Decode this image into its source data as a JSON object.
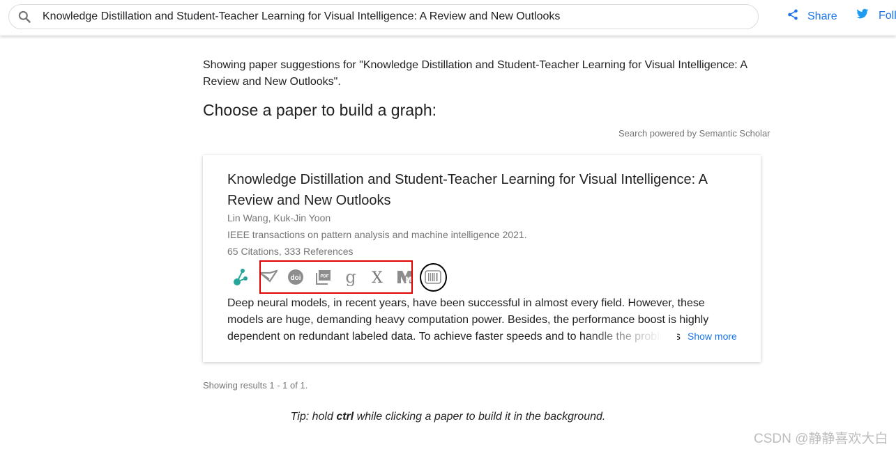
{
  "search": {
    "query": "Knowledge Distillation and Student-Teacher Learning for Visual Intelligence: A Review and New Outlooks"
  },
  "header": {
    "share_label": "Share",
    "follow_label": "Foll"
  },
  "intro_text": "Showing paper suggestions for \"Knowledge Distillation and Student-Teacher Learning for Visual Intelligence: A Review and New Outlooks\".",
  "heading": "Choose a paper to build a graph:",
  "powered_by": "Search powered by Semantic Scholar",
  "paper": {
    "title": "Knowledge Distillation and Student-Teacher Learning for Visual Intelligence: A Review and New Outlooks",
    "authors": "Lin Wang, Kuk-Jin Yoon",
    "venue": "IEEE transactions on pattern analysis and machine intelligence 2021.",
    "stats": "65 Citations, 333 References",
    "icons": [
      "graph-icon",
      "semantic-scholar-icon",
      "doi-icon",
      "pdf-icon",
      "google-scholar-icon",
      "arxiv-icon",
      "microsoft-academic-icon",
      "barcode-icon"
    ],
    "abstract": "Deep neural models, in recent years, have been successful in almost every field. However, these models are huge, demanding heavy computation power. Besides, the performance boost is highly dependent on redundant labeled data. To achieve faster speeds and to handle the problems caused by the lack of labeled data",
    "show_more": "Show more"
  },
  "results_text": "Showing results 1 - 1 of 1.",
  "tip": {
    "prefix": "Tip: hold ",
    "key": "ctrl",
    "suffix": " while clicking a paper to build it in the background."
  },
  "watermark": "CSDN @静静喜欢大白",
  "colors": {
    "accent": "#1a73e8",
    "graph_icon": "#26a69a",
    "highlight_box": "#e00000",
    "ring": "#000000"
  }
}
